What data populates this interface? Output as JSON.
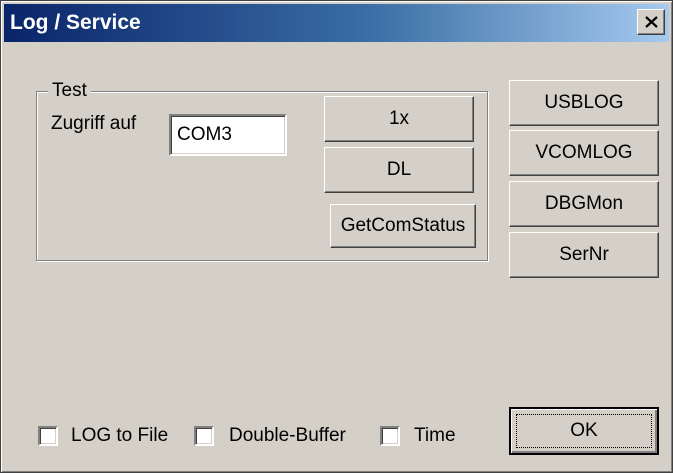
{
  "window": {
    "title": "Log / Service",
    "close_label": "×"
  },
  "group": {
    "legend": "Test",
    "access_label": "Zugriff auf",
    "port_value": "COM3",
    "buttons": {
      "once": "1x",
      "dl": "DL",
      "get_com_status": "GetComStatus"
    }
  },
  "side_buttons": {
    "usblog": "USBLOG",
    "vcomlog": "VCOMLOG",
    "dbgmon": "DBGMon",
    "sernr": "SerNr"
  },
  "options": {
    "log_to_file": {
      "label": "LOG to File",
      "checked": false
    },
    "double_buffer": {
      "label": "Double-Buffer",
      "checked": false
    },
    "time": {
      "label": "Time",
      "checked": false
    }
  },
  "ok_label": "OK",
  "colors": {
    "face": "#d4d0c8",
    "title_start": "#0a246a",
    "title_end": "#a6caf0"
  }
}
